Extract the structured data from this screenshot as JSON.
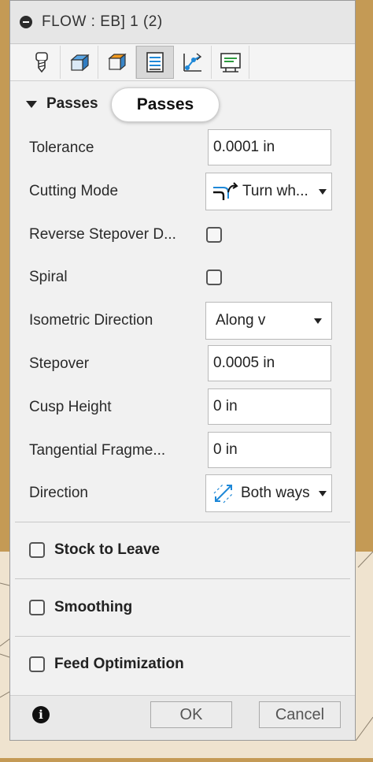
{
  "window": {
    "title": "FLOW : EB] 1 (2)"
  },
  "toolbar": {
    "tabs": [
      {
        "icon": "tool-icon"
      },
      {
        "icon": "geometry-icon"
      },
      {
        "icon": "heights-icon"
      },
      {
        "icon": "passes-icon",
        "active": true
      },
      {
        "icon": "linking-icon"
      },
      {
        "icon": "post-process-icon"
      }
    ]
  },
  "section": {
    "title": "Passes",
    "tooltip": "Passes"
  },
  "fields": {
    "tolerance": {
      "label": "Tolerance",
      "value": "0.0001 in"
    },
    "cutting_mode": {
      "label": "Cutting Mode",
      "value": "Turn wh..."
    },
    "reverse_stepover": {
      "label": "Reverse Stepover D...",
      "checked": false
    },
    "spiral": {
      "label": "Spiral",
      "checked": false
    },
    "isometric_direction": {
      "label": "Isometric Direction",
      "value": "Along v"
    },
    "stepover": {
      "label": "Stepover",
      "value": "0.0005 in"
    },
    "cusp_height": {
      "label": "Cusp Height",
      "value": "0 in"
    },
    "tangential_fragment": {
      "label": "Tangential Fragme...",
      "value": "0 in"
    },
    "direction": {
      "label": "Direction",
      "value": "Both ways"
    }
  },
  "groups": {
    "stock_to_leave": {
      "label": "Stock to Leave",
      "checked": false
    },
    "smoothing": {
      "label": "Smoothing",
      "checked": false
    },
    "feed_optimization": {
      "label": "Feed Optimization",
      "checked": false
    }
  },
  "footer": {
    "ok_label": "OK",
    "cancel_label": "Cancel",
    "info_icon": "i"
  },
  "colors": {
    "accent_blue": "#1e88d8",
    "panel_bg": "#f1f1f1"
  }
}
